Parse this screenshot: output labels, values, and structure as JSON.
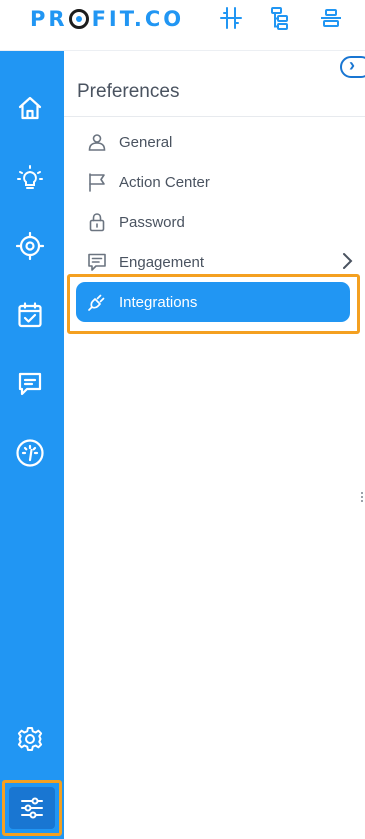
{
  "brand": {
    "logo_left": "PR",
    "logo_right": "FIT.CO"
  },
  "colors": {
    "accent": "#2196f3",
    "accent_dark": "#1976d2",
    "highlight": "#f4a020",
    "text": "#4a5360"
  },
  "header_icons": [
    "timeline-icon",
    "hierarchy-icon",
    "align-center-icon"
  ],
  "rail": {
    "items": [
      {
        "icon": "home-icon"
      },
      {
        "icon": "lightbulb-icon"
      },
      {
        "icon": "target-icon"
      },
      {
        "icon": "calendar-check-icon"
      },
      {
        "icon": "chat-icon"
      },
      {
        "icon": "gauge-icon"
      }
    ],
    "bottom_items": [
      {
        "icon": "gear-icon"
      },
      {
        "icon": "sliders-icon",
        "active": true
      }
    ]
  },
  "preferences": {
    "title": "Preferences",
    "items": [
      {
        "label": "General",
        "icon": "user-icon"
      },
      {
        "label": "Action Center",
        "icon": "flag-icon"
      },
      {
        "label": "Password",
        "icon": "lock-icon"
      },
      {
        "label": "Engagement",
        "icon": "message-icon",
        "has_submenu": true
      },
      {
        "label": "Integrations",
        "icon": "plug-icon",
        "active": true
      }
    ]
  }
}
